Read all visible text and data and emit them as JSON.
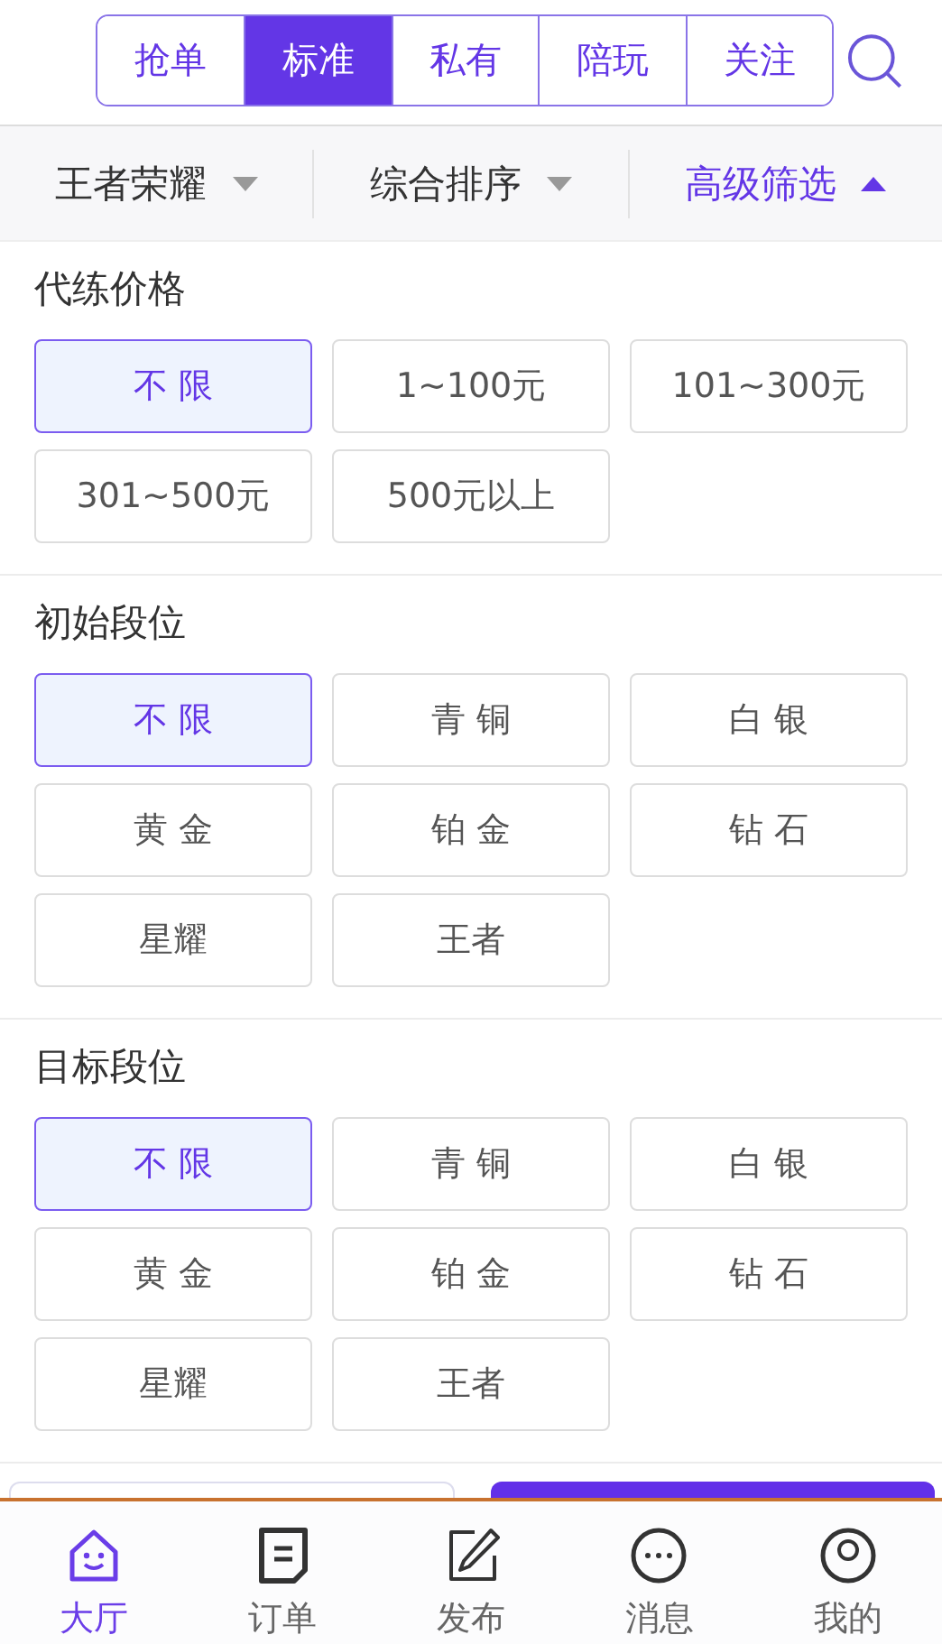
{
  "tabs": [
    {
      "label": "抢单",
      "selected": false
    },
    {
      "label": "标准",
      "selected": true
    },
    {
      "label": "私有",
      "selected": false
    },
    {
      "label": "陪玩",
      "selected": false
    },
    {
      "label": "关注",
      "selected": false
    }
  ],
  "filter_bar": [
    {
      "label": "王者荣耀",
      "expanded": false
    },
    {
      "label": "综合排序",
      "expanded": false
    },
    {
      "label": "高级筛选",
      "expanded": true
    }
  ],
  "sections": [
    {
      "title": "代练价格",
      "options": [
        {
          "label": "不 限",
          "selected": true
        },
        {
          "label": "1~100元",
          "selected": false
        },
        {
          "label": "101~300元",
          "selected": false
        },
        {
          "label": "301~500元",
          "selected": false
        },
        {
          "label": "500元以上",
          "selected": false
        }
      ]
    },
    {
      "title": "初始段位",
      "options": [
        {
          "label": "不 限",
          "selected": true
        },
        {
          "label": "青 铜",
          "selected": false
        },
        {
          "label": "白 银",
          "selected": false
        },
        {
          "label": "黄 金",
          "selected": false
        },
        {
          "label": "铂 金",
          "selected": false
        },
        {
          "label": "钻 石",
          "selected": false
        },
        {
          "label": "星耀",
          "selected": false
        },
        {
          "label": "王者",
          "selected": false
        }
      ]
    },
    {
      "title": "目标段位",
      "options": [
        {
          "label": "不 限",
          "selected": true
        },
        {
          "label": "青 铜",
          "selected": false
        },
        {
          "label": "白 银",
          "selected": false
        },
        {
          "label": "黄 金",
          "selected": false
        },
        {
          "label": "铂 金",
          "selected": false
        },
        {
          "label": "钻 石",
          "selected": false
        },
        {
          "label": "星耀",
          "selected": false
        },
        {
          "label": "王者",
          "selected": false
        }
      ]
    }
  ],
  "actions": [
    {
      "kind": "secondary"
    },
    {
      "kind": "primary"
    }
  ],
  "nav": [
    {
      "label": "大厅",
      "selected": true
    },
    {
      "label": "订单",
      "selected": false
    },
    {
      "label": "发布",
      "selected": false
    },
    {
      "label": "消息",
      "selected": false
    },
    {
      "label": "我的",
      "selected": false
    }
  ]
}
